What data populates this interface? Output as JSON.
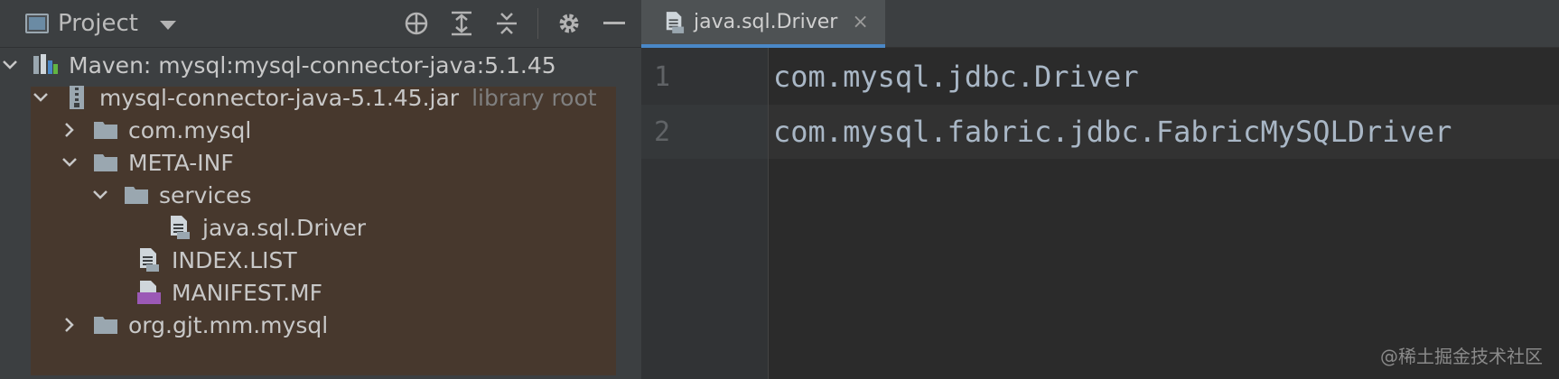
{
  "project_panel": {
    "title": "Project",
    "toolbar_icons": [
      "locate-icon",
      "expand-all-icon",
      "collapse-all-icon",
      "gear-icon",
      "minimize-icon"
    ]
  },
  "tree": {
    "items": [
      {
        "label": "Maven: mysql:mysql-connector-java:5.1.45",
        "icon": "library-icon",
        "expanded": true
      },
      {
        "label": "mysql-connector-java-5.1.45.jar",
        "suffix": "library root",
        "icon": "jar-icon",
        "expanded": true
      },
      {
        "label": "com.mysql",
        "icon": "folder-icon",
        "expanded": false
      },
      {
        "label": "META-INF",
        "icon": "folder-icon",
        "expanded": true
      },
      {
        "label": "services",
        "icon": "folder-icon",
        "expanded": true
      },
      {
        "label": "java.sql.Driver",
        "icon": "text-file-icon"
      },
      {
        "label": "INDEX.LIST",
        "icon": "text-file-icon"
      },
      {
        "label": "MANIFEST.MF",
        "icon": "manifest-file-icon",
        "icon_text": "MF"
      },
      {
        "label": "org.gjt.mm.mysql",
        "icon": "folder-icon",
        "expanded": false
      }
    ]
  },
  "editor": {
    "tab": {
      "label": "java.sql.Driver",
      "close": "×"
    },
    "lines": [
      {
        "number": "1",
        "text": "com.mysql.jdbc.Driver"
      },
      {
        "number": "2",
        "text": "com.mysql.fabric.jdbc.FabricMySQLDriver"
      }
    ]
  },
  "watermark": "@稀土掘金技术社区",
  "colors": {
    "panel_bg": "#3c3f41",
    "editor_bg": "#2b2b2b",
    "selection_bg": "#47382d",
    "tab_accent": "#4a88c7",
    "code_text": "#a9b7c6"
  }
}
